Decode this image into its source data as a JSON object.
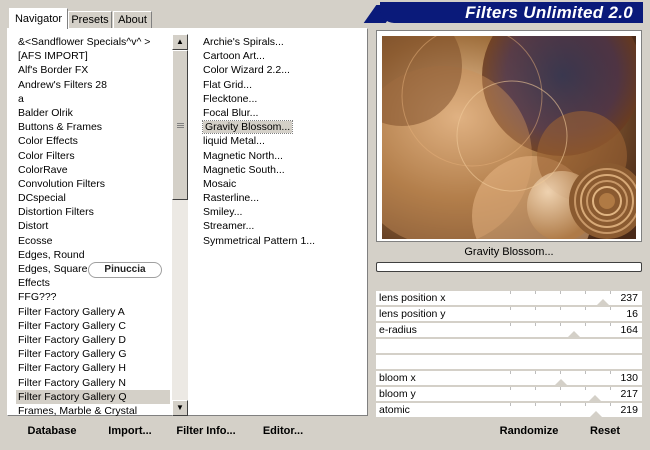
{
  "app": {
    "title": "Filters Unlimited 2.0"
  },
  "tabs": [
    {
      "label": "Navigator"
    },
    {
      "label": "Presets"
    },
    {
      "label": "About"
    }
  ],
  "categories": {
    "items": [
      "&<Sandflower Specials^v^ >",
      "[AFS IMPORT]",
      "Alf's Border FX",
      "Andrew's Filters 28",
      "a",
      "Balder Olrik",
      "Buttons & Frames",
      "Color Effects",
      "Color Filters",
      "ColorRave",
      "Convolution Filters",
      "DCspecial",
      "Distortion Filters",
      "Distort",
      "Ecosse",
      "Edges, Round",
      "Edges, Square",
      "Effects",
      "FFG???",
      "Filter Factory Gallery A",
      "Filter Factory Gallery C",
      "Filter Factory Gallery D",
      "Filter Factory Gallery G",
      "Filter Factory Gallery H",
      "Filter Factory Gallery N",
      "Filter Factory Gallery Q",
      "Frames, Marble & Crystal"
    ],
    "selected": "Filter Factory Gallery Q"
  },
  "filters": {
    "items": [
      "Archie's Spirals...",
      "Cartoon Art...",
      "Color Wizard 2.2...",
      "Flat Grid...",
      "Flecktone...",
      "Focal Blur...",
      "Gravity Blossom...",
      "liquid Metal...",
      "Magnetic North...",
      "Magnetic South...",
      "Mosaic",
      "Rasterline...",
      "Smiley...",
      "Streamer...",
      "Symmetrical Pattern 1..."
    ],
    "selected": "Gravity Blossom..."
  },
  "watermark": "Pinuccia",
  "preview": {
    "filter_name": "Gravity Blossom...",
    "progress": 0
  },
  "params": [
    {
      "label": "lens position x",
      "value": "237",
      "slider": 0.93
    },
    {
      "label": "lens position y",
      "value": "16",
      "slider": null
    },
    {
      "label": "e-radius",
      "value": "164",
      "slider": 0.64
    },
    {
      "label": "",
      "value": "",
      "slider": null
    },
    {
      "label": "",
      "value": "",
      "slider": null
    },
    {
      "label": "bloom x",
      "value": "130",
      "slider": 0.51
    },
    {
      "label": "bloom y",
      "value": "217",
      "slider": 0.85
    },
    {
      "label": "atomic",
      "value": "219",
      "slider": 0.86
    }
  ],
  "buttons": {
    "database": "Database",
    "import": "Import...",
    "filter_info": "Filter Info...",
    "editor": "Editor...",
    "randomize": "Randomize",
    "reset": "Reset"
  },
  "colors": {
    "banner": "#0a1a7a",
    "selection": "#d4d0c8"
  }
}
